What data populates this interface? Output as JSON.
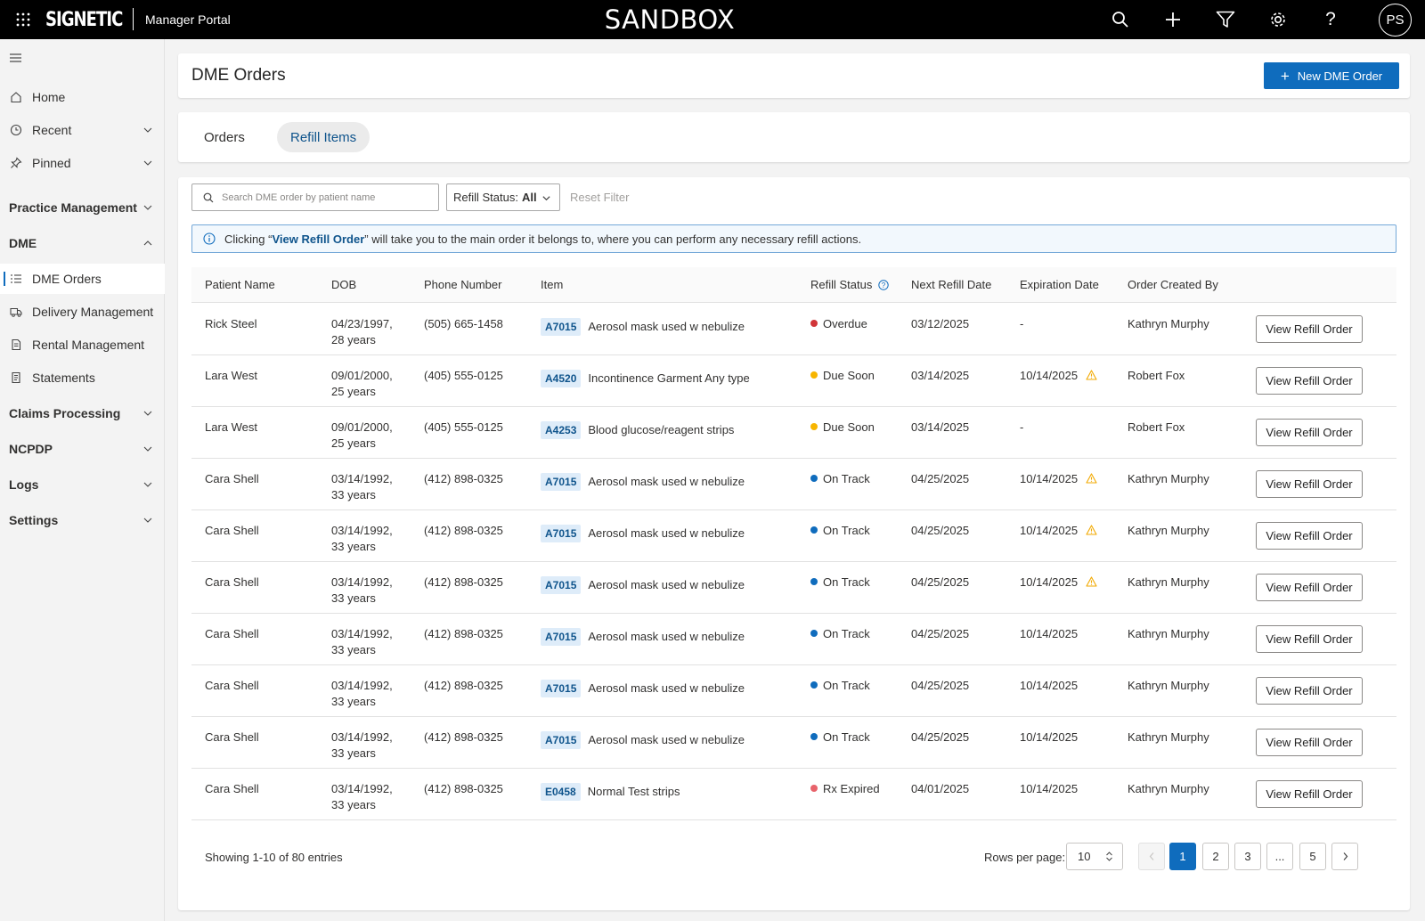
{
  "topbar": {
    "brand": "SIGNETIC",
    "portal": "Manager Portal",
    "env_label": "SANDBOX",
    "user_initials": "PS",
    "icons": [
      "waffle-icon",
      "search-icon",
      "plus-icon",
      "filter-icon",
      "gear-icon",
      "help-icon"
    ]
  },
  "sidebar": {
    "home": "Home",
    "recent": "Recent",
    "pinned": "Pinned",
    "practice_management": "Practice Management",
    "dme": "DME",
    "dme_items": [
      "DME Orders",
      "Delivery Management",
      "Rental Management",
      "Statements"
    ],
    "claims_processing": "Claims Processing",
    "ncpdp": "NCPDP",
    "logs": "Logs",
    "settings": "Settings"
  },
  "header": {
    "title": "DME Orders",
    "new_button": "New DME Order"
  },
  "tabs": [
    {
      "label": "Orders",
      "selected": false
    },
    {
      "label": "Refill Items",
      "selected": true
    }
  ],
  "filters": {
    "search_placeholder": "Search DME order by patient name",
    "status_label": "Refill Status:",
    "status_value": "All",
    "reset": "Reset Filter"
  },
  "info": {
    "before": "Clicking “",
    "link": "View Refill Order",
    "after": "” will take you to the main order it belongs to, where you can perform any necessary refill actions."
  },
  "table": {
    "columns": [
      "Patient Name",
      "DOB",
      "Phone Number",
      "Item",
      "Refill Status",
      "Next Refill Date",
      "Expiration Date",
      "Order Created By"
    ],
    "action_label": "View Refill Order",
    "status_colors": {
      "Overdue": "#d13438",
      "Due Soon": "#f7b500",
      "On Track": "#0f6cbd",
      "Rx Expired": "#e8636b"
    },
    "rows": [
      {
        "patient": "Rick Steel",
        "dob": "04/23/1997,",
        "age": "28 years",
        "phone": "(505) 665-1458",
        "code": "A7015",
        "item": "Aerosol mask used w nebulize",
        "status": "Overdue",
        "next": "03/12/2025",
        "expiration": "-",
        "warn": false,
        "created_by": "Kathryn Murphy"
      },
      {
        "patient": "Lara West",
        "dob": "09/01/2000,",
        "age": "25 years",
        "phone": "(405) 555-0125",
        "code": "A4520",
        "item": "Incontinence Garment Any type",
        "status": "Due Soon",
        "next": "03/14/2025",
        "expiration": "10/14/2025",
        "warn": true,
        "created_by": "Robert Fox"
      },
      {
        "patient": "Lara West",
        "dob": "09/01/2000,",
        "age": "25 years",
        "phone": "(405) 555-0125",
        "code": "A4253",
        "item": "Blood glucose/reagent strips",
        "status": "Due Soon",
        "next": "03/14/2025",
        "expiration": "-",
        "warn": false,
        "created_by": "Robert Fox"
      },
      {
        "patient": "Cara Shell",
        "dob": "03/14/1992,",
        "age": "33 years",
        "phone": "(412) 898-0325",
        "code": "A7015",
        "item": "Aerosol mask used w nebulize",
        "status": "On Track",
        "next": "04/25/2025",
        "expiration": "10/14/2025",
        "warn": true,
        "created_by": "Kathryn Murphy"
      },
      {
        "patient": "Cara Shell",
        "dob": "03/14/1992,",
        "age": "33 years",
        "phone": "(412) 898-0325",
        "code": "A7015",
        "item": "Aerosol mask used w nebulize",
        "status": "On Track",
        "next": "04/25/2025",
        "expiration": "10/14/2025",
        "warn": true,
        "created_by": "Kathryn Murphy"
      },
      {
        "patient": "Cara Shell",
        "dob": "03/14/1992,",
        "age": "33 years",
        "phone": "(412) 898-0325",
        "code": "A7015",
        "item": "Aerosol mask used w nebulize",
        "status": "On Track",
        "next": "04/25/2025",
        "expiration": "10/14/2025",
        "warn": true,
        "created_by": "Kathryn Murphy"
      },
      {
        "patient": "Cara Shell",
        "dob": "03/14/1992,",
        "age": "33 years",
        "phone": "(412) 898-0325",
        "code": "A7015",
        "item": "Aerosol mask used w nebulize",
        "status": "On Track",
        "next": "04/25/2025",
        "expiration": "10/14/2025",
        "warn": false,
        "created_by": "Kathryn Murphy"
      },
      {
        "patient": "Cara Shell",
        "dob": "03/14/1992,",
        "age": "33 years",
        "phone": "(412) 898-0325",
        "code": "A7015",
        "item": "Aerosol mask used w nebulize",
        "status": "On Track",
        "next": "04/25/2025",
        "expiration": "10/14/2025",
        "warn": false,
        "created_by": "Kathryn Murphy"
      },
      {
        "patient": "Cara Shell",
        "dob": "03/14/1992,",
        "age": "33 years",
        "phone": "(412) 898-0325",
        "code": "A7015",
        "item": "Aerosol mask used w nebulize",
        "status": "On Track",
        "next": "04/25/2025",
        "expiration": "10/14/2025",
        "warn": false,
        "created_by": "Kathryn Murphy"
      },
      {
        "patient": "Cara Shell",
        "dob": "03/14/1992,",
        "age": "33 years",
        "phone": "(412) 898-0325",
        "code": "E0458",
        "item": "Normal Test strips",
        "status": "Rx Expired",
        "next": "04/01/2025",
        "expiration": "10/14/2025",
        "warn": false,
        "created_by": "Kathryn Murphy"
      }
    ]
  },
  "pagination": {
    "summary": "Showing 1-10 of 80 entries",
    "rows_label": "Rows per page:",
    "rows_value": "10",
    "pages": [
      "1",
      "2",
      "3",
      "...",
      "5"
    ],
    "current": "1"
  },
  "colors": {
    "accent": "#0f6cbd",
    "warning": "#f7b500"
  }
}
